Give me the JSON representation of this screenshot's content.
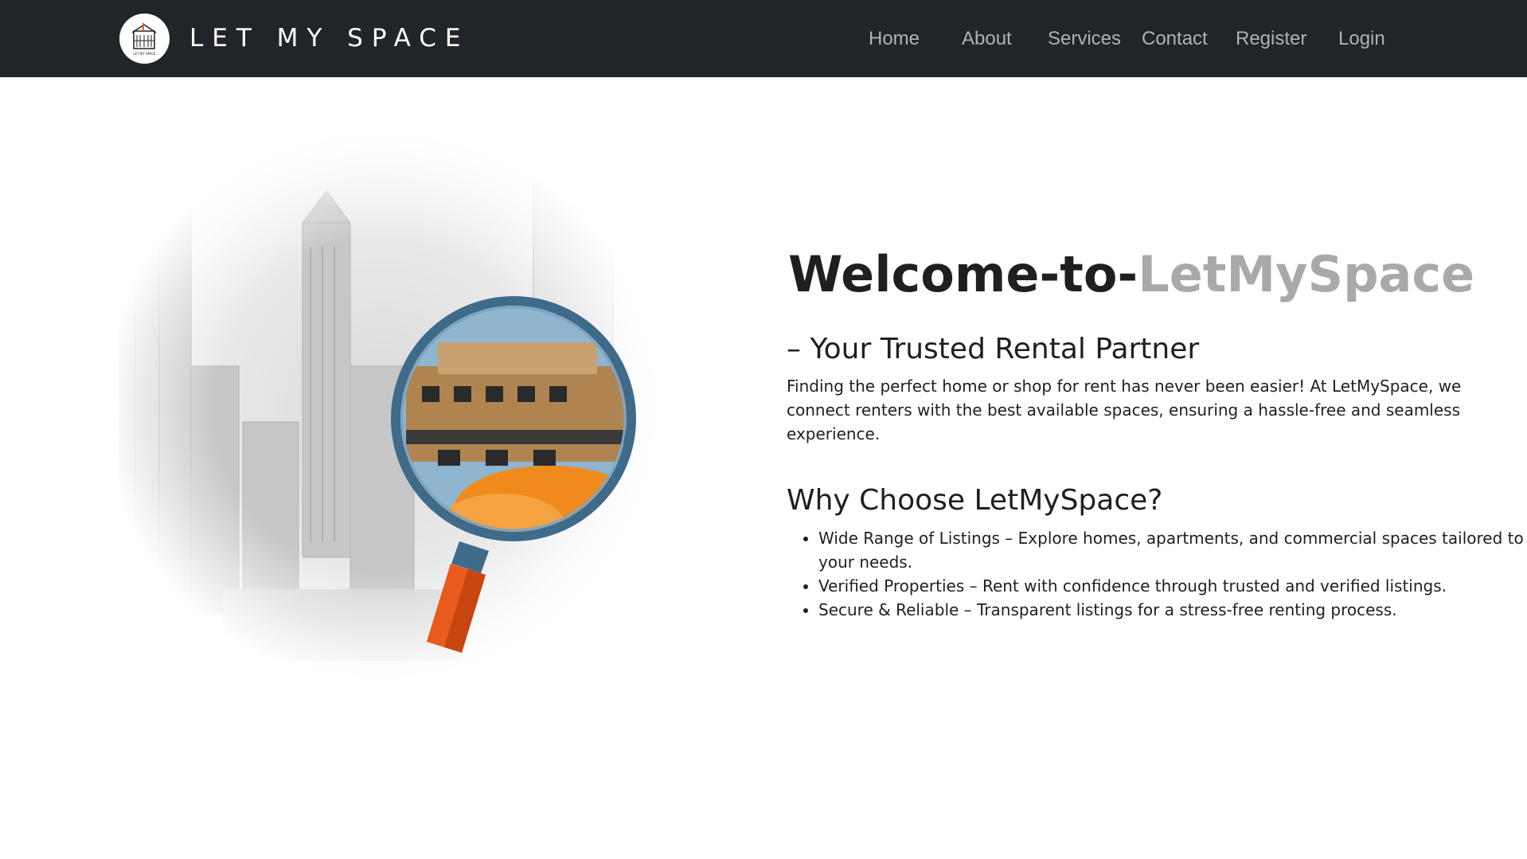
{
  "brand": {
    "name": "LET MY SPACE",
    "logo_caption": "LET MY SPACE"
  },
  "nav": {
    "items": [
      {
        "label": "Home"
      },
      {
        "label": "About"
      },
      {
        "label": "Services"
      },
      {
        "label": "Contact"
      },
      {
        "label": "Register"
      },
      {
        "label": "Login"
      }
    ]
  },
  "hero": {
    "title_main": "Welcome-to-",
    "title_faded": "LetMySpace",
    "subtitle": "– Your Trusted Rental Partner",
    "intro": "Finding the perfect home or shop for rent has never been easier! At LetMySpace, we connect renters with the best available spaces, ensuring a hassle-free and seamless experience.",
    "why_heading": "Why Choose LetMySpace?",
    "features": [
      {
        "text": "Wide Range of Listings – Explore homes, apartments, and commercial spaces tailored to your needs."
      },
      {
        "text": "Verified Properties – Rent with confidence through trusted and verified listings."
      },
      {
        "text": "Secure & Reliable – Transparent listings for a stress-free renting process."
      }
    ]
  },
  "colors": {
    "navbar_bg": "#212529",
    "nav_link": "#aeb2b7",
    "title_faded": "#a9a9a9",
    "magnifier_rim": "#3f6b8a",
    "magnifier_handle": "#e85a1e"
  },
  "icons": {
    "logo": "building-logo-icon",
    "hero": "magnifying-glass-city-illustration"
  }
}
